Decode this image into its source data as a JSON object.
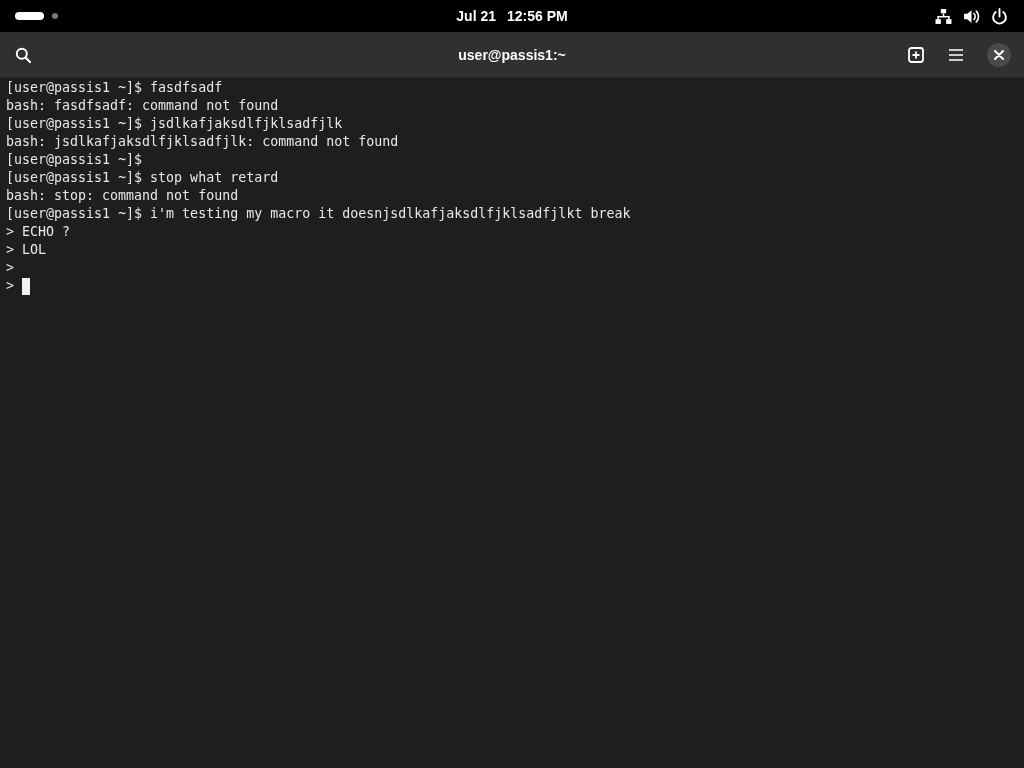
{
  "top_bar": {
    "workspaces": [
      {
        "selected": true
      },
      {
        "selected": false
      }
    ],
    "date": "Jul 21",
    "time": "12:56 PM"
  },
  "header_bar": {
    "title": "user@passis1:~"
  },
  "terminal": {
    "lines": [
      "[user@passis1 ~]$ fasdfsadf",
      "bash: fasdfsadf: command not found",
      "[user@passis1 ~]$ jsdlkafjaksdlfjklsadfjlk",
      "bash: jsdlkafjaksdlfjklsadfjlk: command not found",
      "[user@passis1 ~]$",
      "[user@passis1 ~]$ stop what retard",
      "bash: stop: command not found",
      "[user@passis1 ~]$ i'm testing my macro it doesnjsdlkafjaksdlfjklsadfjlkt break",
      "> ECHO ?",
      "> LOL",
      ">",
      "> "
    ],
    "cursor": true
  }
}
